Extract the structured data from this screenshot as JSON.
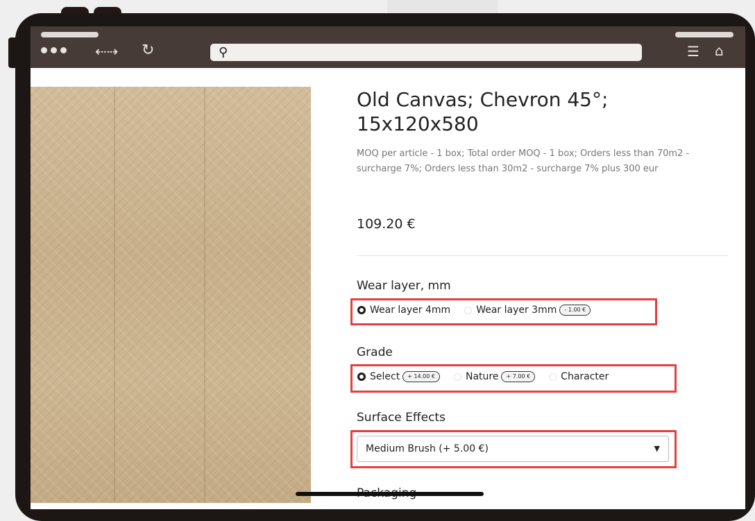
{
  "product": {
    "title": "Old Canvas; Chevron 45°; 15x120x580",
    "description": "MOQ per article - 1 box; Total order MOQ - 1 box; Orders less than 70m2 - surcharge 7%; Orders less than 30m2 - surcharge 7% plus 300 eur",
    "price": "109.20 €"
  },
  "wear_layer": {
    "label": "Wear layer, mm",
    "options": [
      {
        "label": "Wear layer 4mm",
        "selected": true,
        "badge": ""
      },
      {
        "label": "Wear layer 3mm",
        "selected": false,
        "badge": "- 1.00 €"
      }
    ]
  },
  "grade": {
    "label": "Grade",
    "options": [
      {
        "label": "Select",
        "selected": true,
        "badge": "+ 14.00 €"
      },
      {
        "label": "Nature",
        "selected": false,
        "badge": "+ 7.00 €"
      },
      {
        "label": "Character",
        "selected": false,
        "badge": ""
      }
    ]
  },
  "surface_effects": {
    "label": "Surface Effects",
    "selected_value": "Medium Brush (+ 5.00 €)"
  },
  "packaging": {
    "label": "Packaging"
  },
  "colors": {
    "highlight_box": "#e53e3e",
    "browser_bar": "#473b38",
    "device_frame": "#1c1715"
  },
  "icons": [
    "search-icon",
    "back-forward-icon",
    "reload-icon",
    "menu-icon",
    "home-icon",
    "caret-down-icon"
  ]
}
